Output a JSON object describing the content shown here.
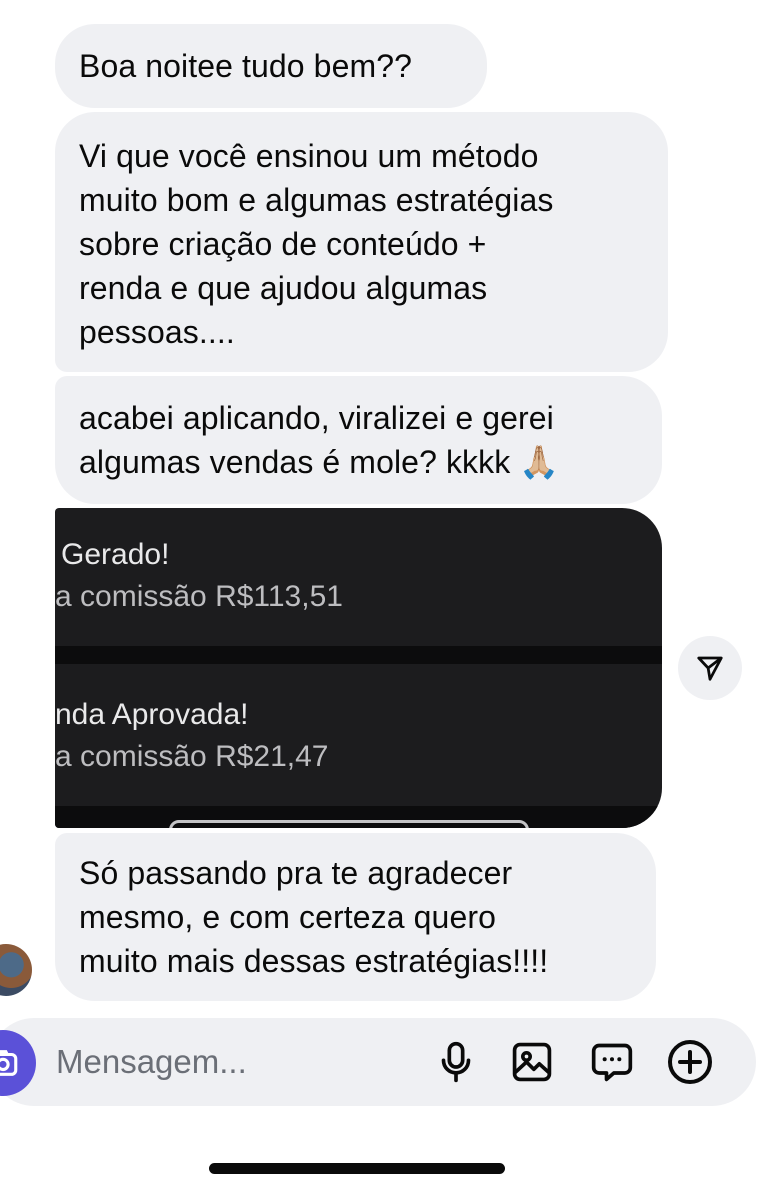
{
  "messages": [
    {
      "text": "Boa noitee tudo bem??"
    },
    {
      "text": "Vi que você ensinou um método\nmuito bom e algumas estratégias\nsobre criação de conteúdo +\nrenda e que ajudou algumas\npessoas...."
    },
    {
      "text": "acabei aplicando, viralizei e gerei\nalgumas vendas é mole? kkkk 🙏🏼"
    },
    {
      "text": "Só passando pra te agradecer\nmesmo, e com certeza quero\nmuito mais dessas estratégias!!!!"
    }
  ],
  "shared_image": {
    "notifications": [
      {
        "title": " Gerado!",
        "text": "a comissão R$113,51"
      },
      {
        "title": "nda Aprovada!",
        "text": "a comissão R$21,47"
      }
    ]
  },
  "composer": {
    "placeholder": "Mensagem..."
  },
  "icons": {
    "share": "send-icon",
    "camera": "camera-icon",
    "mic": "microphone-icon",
    "gallery": "image-icon",
    "sticker": "sticker-icon",
    "more": "plus-circle-icon"
  },
  "colors": {
    "bubble": "#eff0f3",
    "accent": "#5b51d8",
    "image_bg": "#1c1c1e"
  }
}
